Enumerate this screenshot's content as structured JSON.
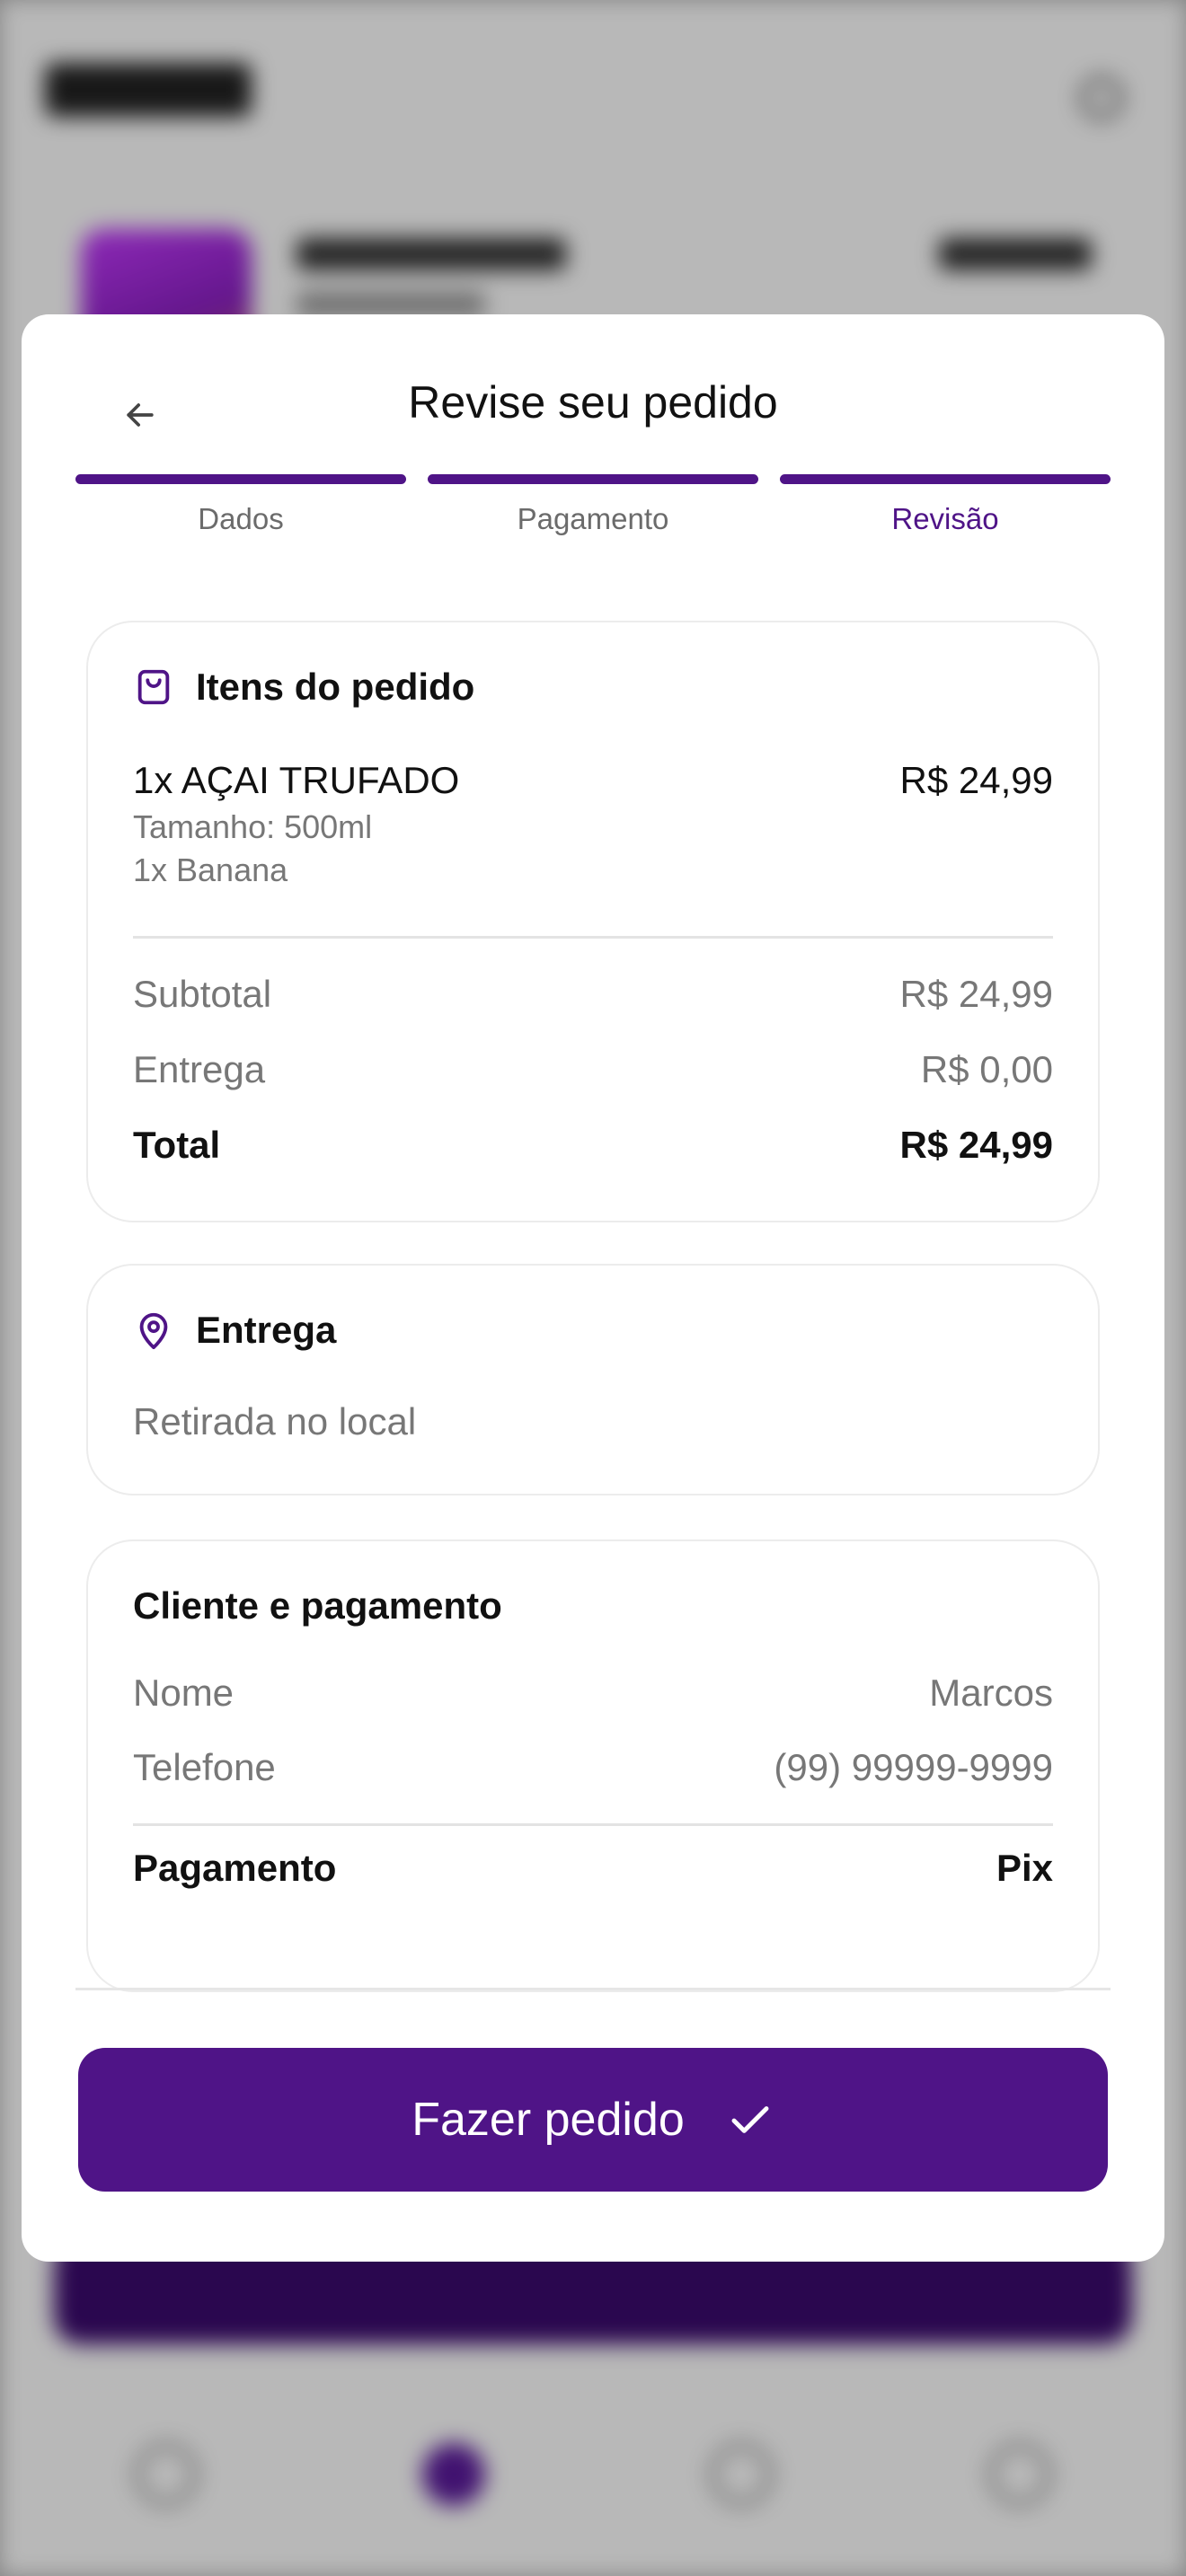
{
  "header": {
    "title": "Revise seu pedido",
    "back_icon": "arrow-left-icon"
  },
  "steps": [
    {
      "label": "Dados",
      "state": "completed"
    },
    {
      "label": "Pagamento",
      "state": "completed"
    },
    {
      "label": "Revisão",
      "state": "current"
    }
  ],
  "order_items": {
    "title": "Itens do pedido",
    "icon": "shopping-bag-icon",
    "items": [
      {
        "name": "1x AÇAI TRUFADO",
        "price": "R$ 24,99",
        "details": [
          "Tamanho: 500ml",
          "1x Banana"
        ]
      }
    ],
    "subtotal_label": "Subtotal",
    "subtotal_value": "R$ 24,99",
    "delivery_label": "Entrega",
    "delivery_value": "R$ 0,00",
    "total_label": "Total",
    "total_value": "R$ 24,99"
  },
  "delivery": {
    "title": "Entrega",
    "icon": "map-pin-icon",
    "method": "Retirada no local"
  },
  "client_payment": {
    "title": "Cliente e pagamento",
    "name_label": "Nome",
    "name_value": "Marcos",
    "phone_label": "Telefone",
    "phone_value": "(99) 99999-9999",
    "payment_label": "Pagamento",
    "payment_value": "Pix"
  },
  "cta": {
    "label": "Fazer pedido",
    "icon": "check-icon"
  },
  "colors": {
    "accent": "#4f1487",
    "text_primary": "#111111",
    "text_secondary": "#777777"
  }
}
